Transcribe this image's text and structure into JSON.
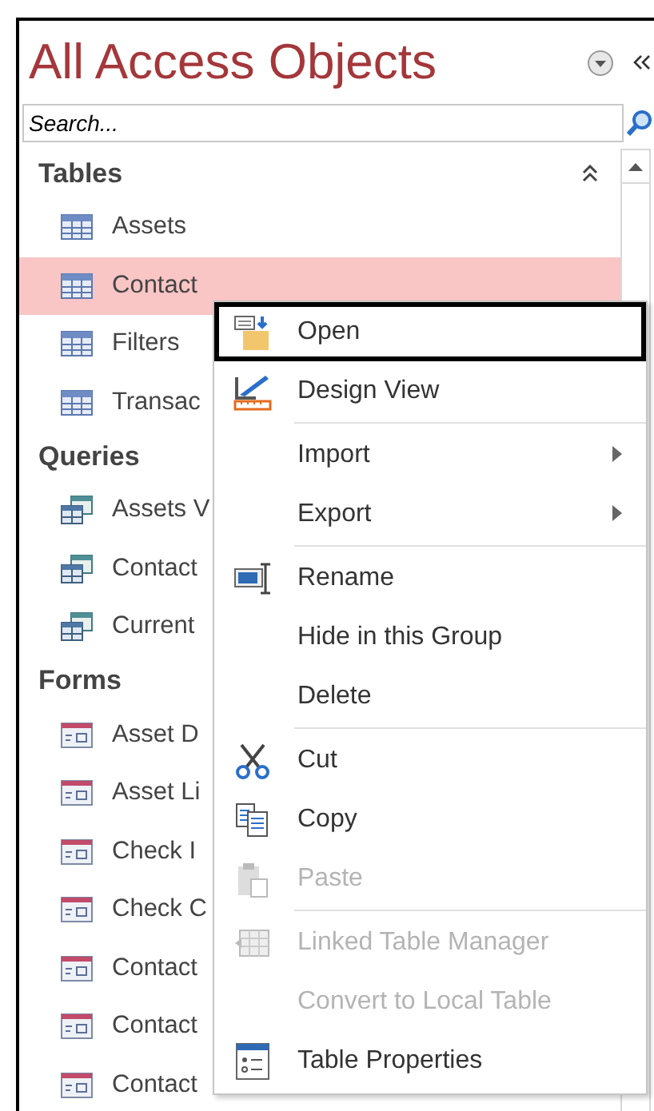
{
  "pane": {
    "title": "All Access Objects",
    "search": {
      "placeholder": "Search..."
    },
    "groups": [
      {
        "label": "Tables",
        "items": [
          {
            "label": "Assets",
            "kind": "table",
            "selected": false
          },
          {
            "label": "Contact",
            "kind": "table",
            "selected": true
          },
          {
            "label": "Filters",
            "kind": "table",
            "selected": false
          },
          {
            "label": "Transac",
            "kind": "table",
            "selected": false
          }
        ]
      },
      {
        "label": "Queries",
        "items": [
          {
            "label": "Assets V",
            "kind": "query",
            "selected": false
          },
          {
            "label": "Contact",
            "kind": "query",
            "selected": false
          },
          {
            "label": "Current",
            "kind": "query",
            "selected": false
          }
        ]
      },
      {
        "label": "Forms",
        "items": [
          {
            "label": "Asset D",
            "kind": "form",
            "selected": false
          },
          {
            "label": "Asset Li",
            "kind": "form",
            "selected": false
          },
          {
            "label": "Check I",
            "kind": "form",
            "selected": false
          },
          {
            "label": "Check C",
            "kind": "form",
            "selected": false
          },
          {
            "label": "Contact",
            "kind": "form",
            "selected": false
          },
          {
            "label": "Contact",
            "kind": "form",
            "selected": false
          },
          {
            "label": "Contact",
            "kind": "form",
            "selected": false
          }
        ]
      }
    ]
  },
  "context_menu": {
    "items": [
      {
        "kind": "command",
        "label": "Open",
        "highlighted": true,
        "disabled": false
      },
      {
        "kind": "command",
        "label": "Design View",
        "highlighted": false,
        "disabled": false
      },
      {
        "kind": "separator"
      },
      {
        "kind": "submenu",
        "label": "Import",
        "highlighted": false,
        "disabled": false
      },
      {
        "kind": "submenu",
        "label": "Export",
        "highlighted": false,
        "disabled": false
      },
      {
        "kind": "separator"
      },
      {
        "kind": "command",
        "label": "Rename",
        "highlighted": false,
        "disabled": false
      },
      {
        "kind": "command",
        "label": "Hide in this Group",
        "highlighted": false,
        "disabled": false
      },
      {
        "kind": "command",
        "label": "Delete",
        "highlighted": false,
        "disabled": false
      },
      {
        "kind": "separator"
      },
      {
        "kind": "command",
        "label": "Cut",
        "highlighted": false,
        "disabled": false
      },
      {
        "kind": "command",
        "label": "Copy",
        "highlighted": false,
        "disabled": false
      },
      {
        "kind": "command",
        "label": "Paste",
        "highlighted": false,
        "disabled": true
      },
      {
        "kind": "separator"
      },
      {
        "kind": "command",
        "label": "Linked Table Manager",
        "highlighted": false,
        "disabled": true
      },
      {
        "kind": "command",
        "label": "Convert to Local Table",
        "highlighted": false,
        "disabled": true
      },
      {
        "kind": "command",
        "label": "Table Properties",
        "highlighted": false,
        "disabled": false
      }
    ]
  }
}
